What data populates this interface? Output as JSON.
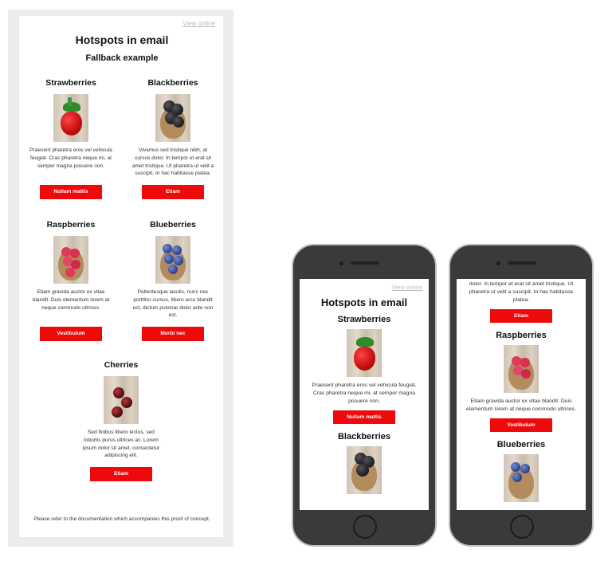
{
  "email": {
    "view_online": "View online",
    "title": "Hotspots in email",
    "subtitle": "Fallback example",
    "footer": "Please refer to the documentation which accompanies this proof of concept.",
    "products": [
      {
        "name": "Strawberries",
        "text": "Praesent pharetra eros vel vehicula feugiat. Cras pharetra neque mi, at semper magna posuere non.",
        "button": "Nullam mattis",
        "icon": "strawberry-photo"
      },
      {
        "name": "Blackberries",
        "text": "Vivamus sed tristique nibh, at cursus dolor. In tempor et erat sit amet tristique. Ut pharetra ut velit a suscipit. In hac habitasse platea.",
        "button": "Etiam",
        "icon": "blackberry-photo"
      },
      {
        "name": "Raspberries",
        "text": "Etiam gravida auctor ex vitae blandit. Duis elementum lorem at neque commodo ultrices.",
        "button": "Vestibulum",
        "icon": "raspberry-photo"
      },
      {
        "name": "Blueberries",
        "text": "Pellentesque iaculis, nunc nec porttitor cursus, libero arcu blandit est, dictum pulvinar dolor ante non est.",
        "button": "Morbi nec",
        "icon": "blueberry-photo"
      },
      {
        "name": "Cherries",
        "text": "Sed finibus libero lectus, sed lobortis purus ultrices ac. Lorem ipsum dolor sit amet, consectetur adipiscing elit.",
        "button": "Etiam",
        "icon": "cherry-photo"
      }
    ]
  },
  "phone1": {
    "view_online": "View online",
    "title": "Hotspots in email",
    "section1": "Strawberries",
    "text1": "Praesent pharetra eros vel vehicula feugiat. Cras pharetra neque mi, at semper magna posuere non.",
    "button1": "Nullam mattis",
    "section2": "Blackberries"
  },
  "phone2": {
    "partial_text": "dolor. In tempor et erat sit amet tristique. Ut pharetra ut velit a suscipit. In hac habitasse platea.",
    "button1": "Etiam",
    "section1": "Raspberries",
    "text1": "Etiam gravida auctor ex vitae blandit. Duis elementum lorem at neque commodo ultrices.",
    "button2": "Vestibulum",
    "section2": "Blueberries"
  },
  "colors": {
    "button_red": "#ee0a0a",
    "frame_gray": "#ececec",
    "phone_body": "#3a3a3c"
  }
}
